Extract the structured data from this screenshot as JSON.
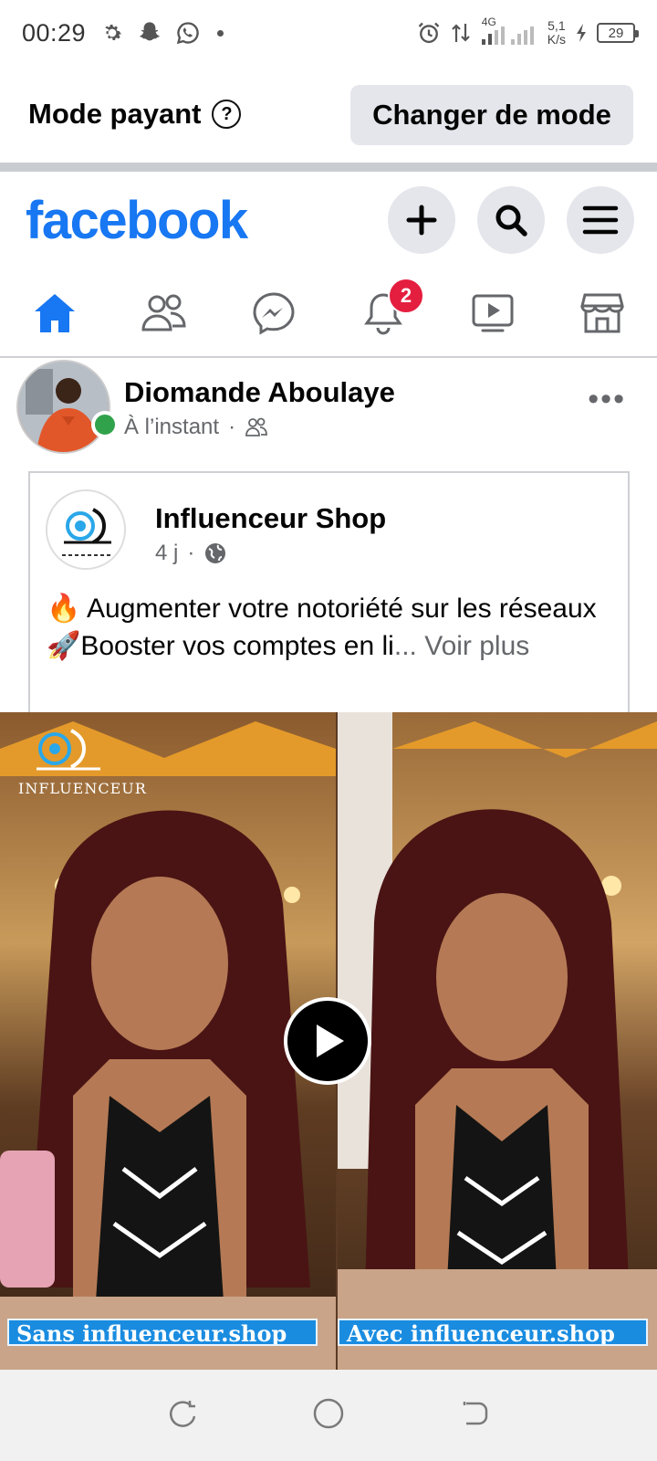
{
  "status_bar": {
    "time": "00:29",
    "network": "4G",
    "speed_value": "5,1",
    "speed_unit": "K/s",
    "battery": "29"
  },
  "mode_bar": {
    "label": "Mode payant",
    "help": "?",
    "button": "Changer de mode"
  },
  "header": {
    "logo": "facebook"
  },
  "nav": {
    "notifications_badge": "2",
    "active_tab": "home"
  },
  "post": {
    "author": "Diomande Aboulaye",
    "time": "À l’instant",
    "separator": "·",
    "more": "•••",
    "shared": {
      "page_name": "Influenceur Shop",
      "time": "4 j",
      "separator": "·",
      "line1": "🔥 Augmenter votre notoriété sur les réseaux",
      "line2": "🚀Booster vos comptes en li",
      "ellipsis": "...",
      "see_more": "Voir plus"
    },
    "media": {
      "logo_text": "INFLUENCEUR",
      "left_caption": "Sans influenceur.shop",
      "right_caption": "Avec influenceur.shop"
    }
  },
  "colors": {
    "brand": "#1877f2",
    "badge": "#e41e3f",
    "online": "#31a24c",
    "caption_bg": "#1a8ce0"
  }
}
